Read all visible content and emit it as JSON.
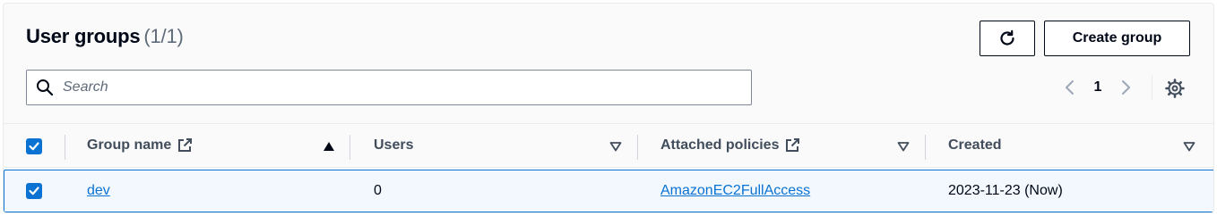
{
  "header": {
    "title": "User groups",
    "count": "(1/1)",
    "create_label": "Create group"
  },
  "search": {
    "placeholder": "Search",
    "value": ""
  },
  "pagination": {
    "current_page": "1"
  },
  "table": {
    "columns": [
      {
        "label": "Group name",
        "sort": "ascending"
      },
      {
        "label": "Users",
        "sort": "none"
      },
      {
        "label": "Attached policies",
        "sort": "none"
      },
      {
        "label": "Created",
        "sort": "none"
      }
    ],
    "rows": [
      {
        "selected": true,
        "group_name": "dev",
        "users": "0",
        "attached_policies": "AmazonEC2FullAccess",
        "created": "2023-11-23 (Now)"
      }
    ]
  },
  "colors": {
    "accent": "#0972d3",
    "text": "#000716",
    "header_text": "#414d5c",
    "selected_row_bg": "#f2f8fd"
  },
  "icons": [
    "refresh-icon",
    "search-icon",
    "chevron-left-icon",
    "chevron-right-icon",
    "settings-gear-icon",
    "external-link-icon",
    "sort-ascending-icon",
    "sort-descending-icon",
    "checkbox-checked-icon"
  ]
}
